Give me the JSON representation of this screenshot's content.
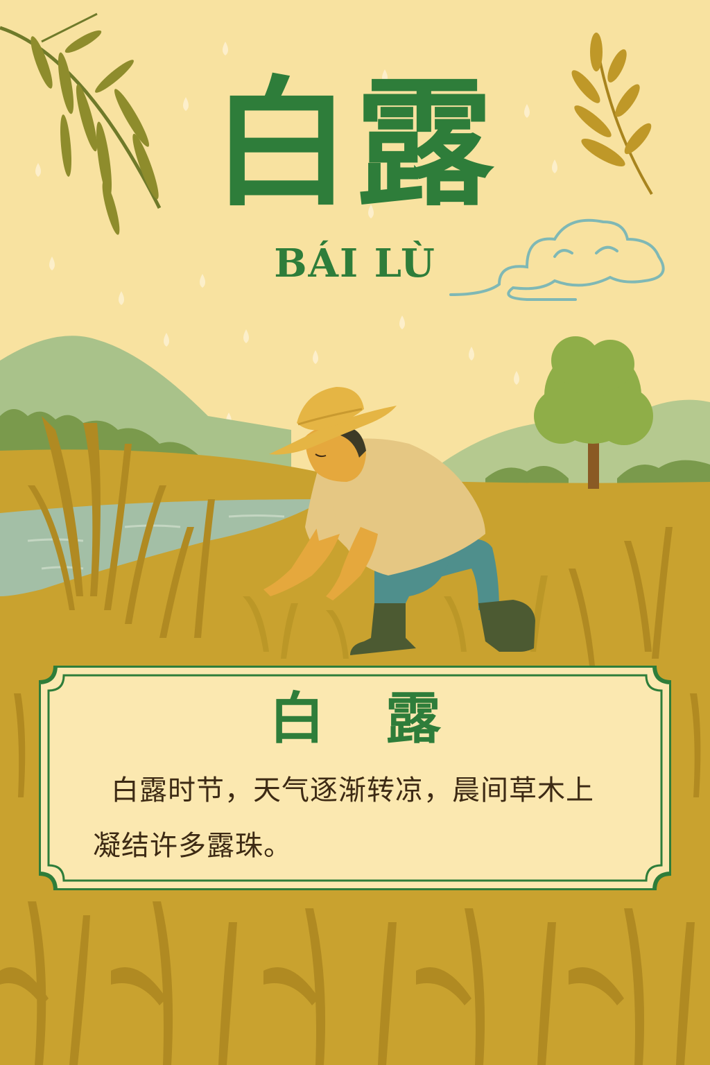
{
  "poster": {
    "title": "白露",
    "pinyin": "BÁI LÙ"
  },
  "card": {
    "title": "白 露",
    "text": "白露时节，天气逐渐转凉，晨间草木上凝结许多露珠。"
  },
  "colors": {
    "background": "#f8e2a0",
    "title_green": "#2e7d3a",
    "field": "#c9a22f",
    "card_bg": "#fbe8b0",
    "text_brown": "#3d2a14"
  },
  "icons": [
    "willow-branch-icon",
    "grain-sprig-icon",
    "cloud-icon",
    "dewdrop-icon",
    "tree-icon"
  ]
}
